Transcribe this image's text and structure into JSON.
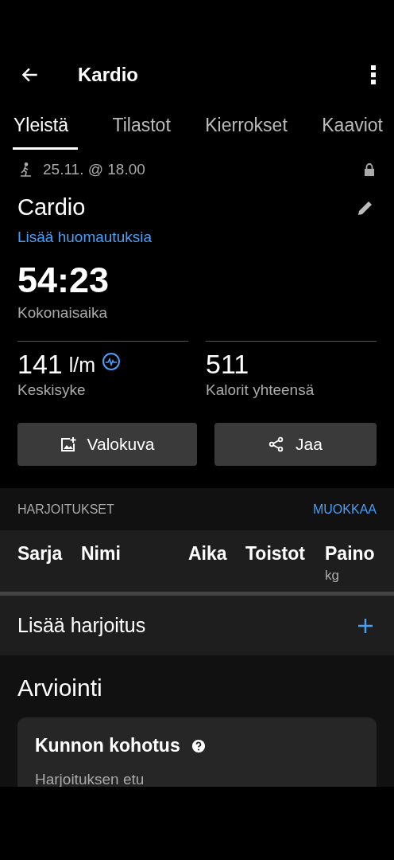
{
  "app_bar": {
    "title": "Kardio"
  },
  "tabs": [
    {
      "label": "Yleistä",
      "selected": true
    },
    {
      "label": "Tilastot",
      "selected": false
    },
    {
      "label": "Kierrokset",
      "selected": false
    },
    {
      "label": "Kaaviot",
      "selected": false
    }
  ],
  "activity": {
    "date": "25.11. @ 18.00",
    "locked": true,
    "name": "Cardio",
    "notes_link": "Lisää huomautuksia"
  },
  "total_time": {
    "value": "54:23",
    "label": "Kokonaisaika"
  },
  "stats": [
    {
      "value": "141",
      "unit": "l/m",
      "label": "Keskisyke",
      "kind": "heart"
    },
    {
      "value": "511",
      "label": "Kalorit yhteensä",
      "kind": "plain"
    }
  ],
  "buttons": [
    {
      "label": "Valokuva",
      "kind": "photo"
    },
    {
      "label": "Jaa",
      "kind": "share"
    }
  ],
  "exercises": {
    "heading": "HARJOITUKSET",
    "edit_link": "MUOKKAA",
    "columns": [
      {
        "label": "Sarja"
      },
      {
        "label": "Nimi"
      },
      {
        "label": "Aika"
      },
      {
        "label": "Toistot"
      },
      {
        "label": "Paino",
        "unit": "kg"
      }
    ],
    "add_label": "Lisää harjoitus"
  },
  "evaluation": {
    "heading": "Arviointi",
    "card_title": "Kunnon kohotus",
    "card_subtitle": "Harjoituksen etu"
  }
}
